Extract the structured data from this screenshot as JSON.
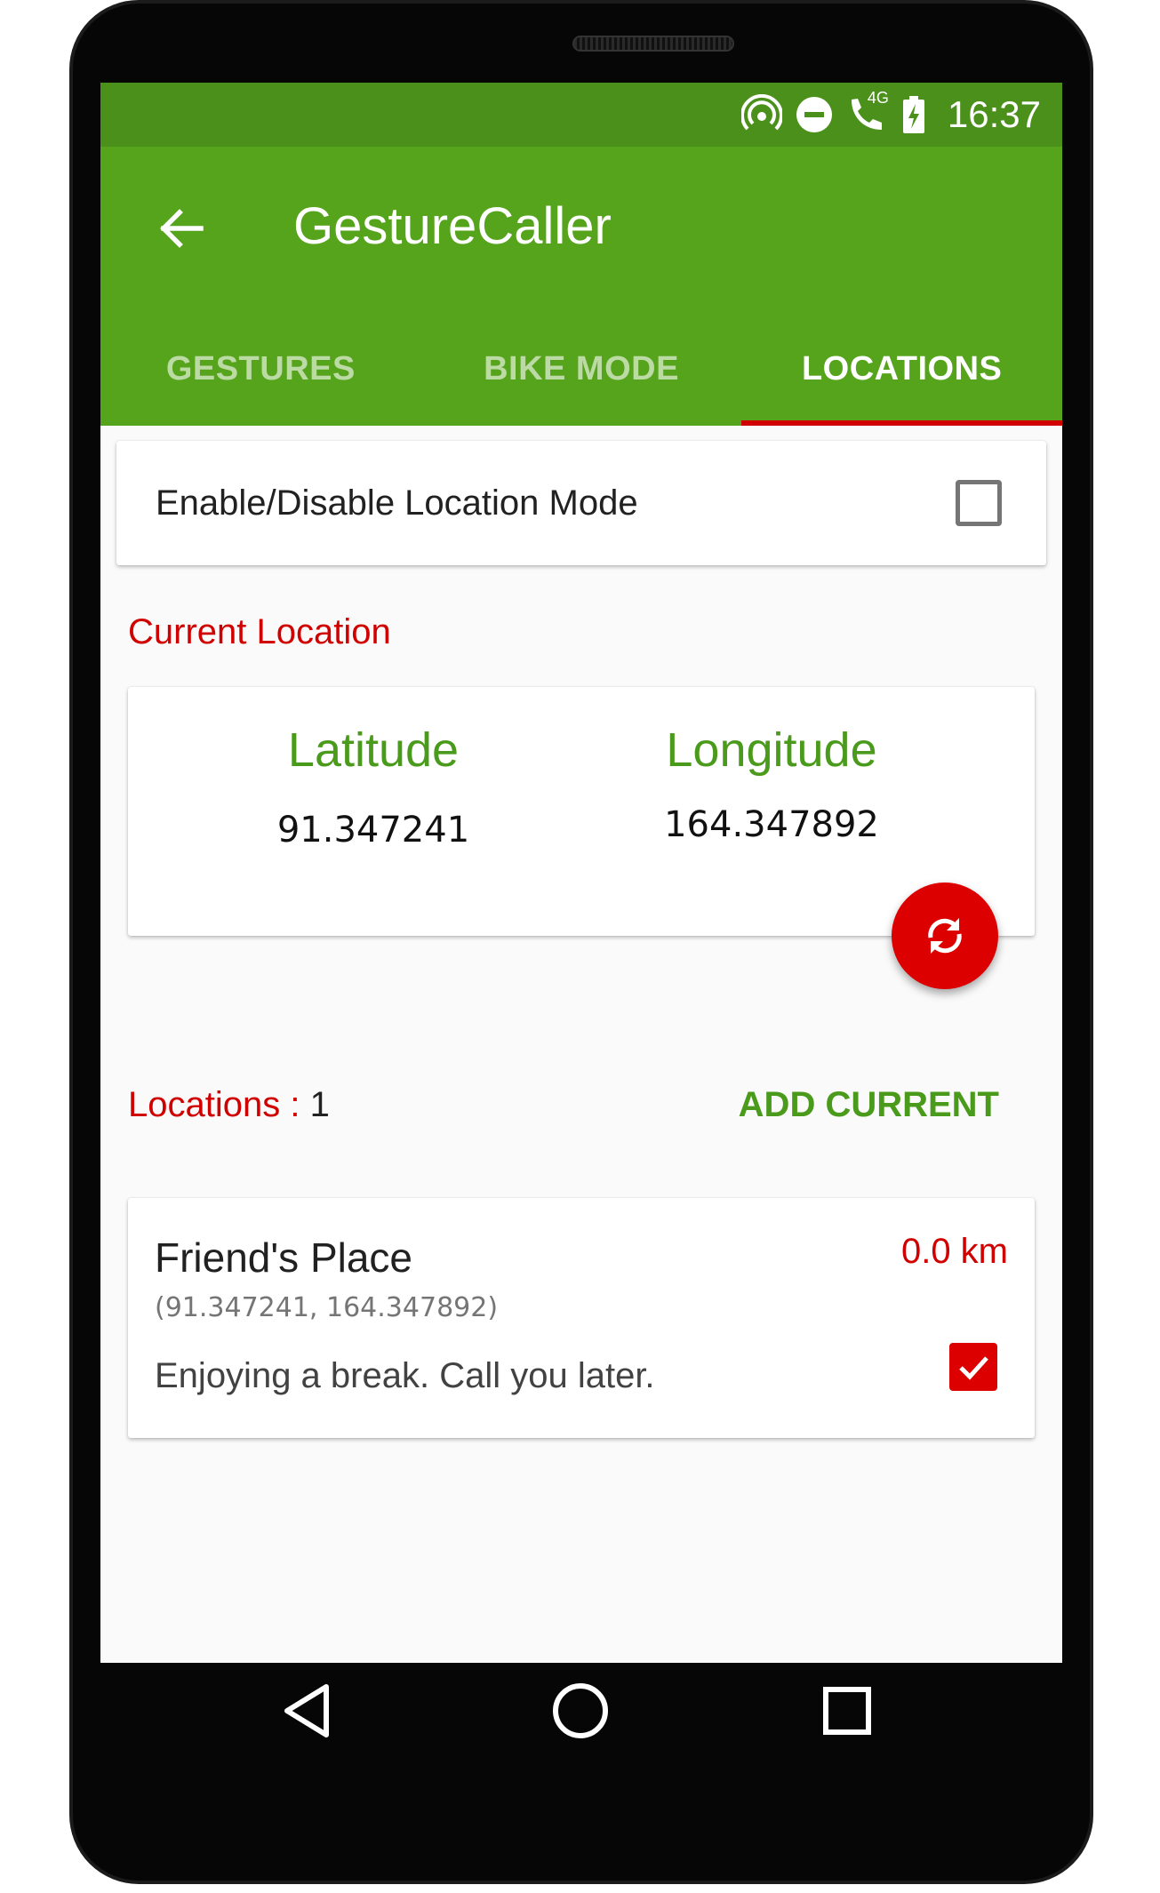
{
  "status_bar": {
    "time": "16:37",
    "icons": [
      "hotspot-icon",
      "do-not-disturb-icon",
      "wifi-calling-icon",
      "battery-charging-icon"
    ],
    "network_label": "4G"
  },
  "app_bar": {
    "title": "GestureCaller"
  },
  "tabs": [
    {
      "label": "GESTURES",
      "active": false
    },
    {
      "label": "BIKE MODE",
      "active": false
    },
    {
      "label": "LOCATIONS",
      "active": true
    }
  ],
  "location_mode": {
    "label": "Enable/Disable Location Mode",
    "enabled": false
  },
  "current_location": {
    "section_label": "Current Location",
    "latitude_label": "Latitude",
    "latitude": "91.347241",
    "longitude_label": "Longitude",
    "longitude": "164.347892"
  },
  "locations": {
    "label": "Locations : ",
    "count": "1",
    "add_label": "ADD CURRENT",
    "items": [
      {
        "name": "Friend's Place",
        "coords": "(91.347241, 164.347892)",
        "message": "Enjoying a break. Call you later.",
        "distance": "0.0 km",
        "checked": true
      }
    ]
  },
  "colors": {
    "status_bar": "#4b901b",
    "app_bar": "#56a31c",
    "accent_red": "#d10000",
    "accent_green": "#4a9a1c"
  }
}
